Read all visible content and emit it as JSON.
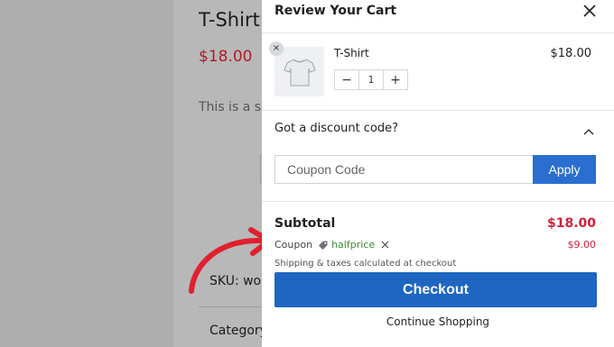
{
  "background_page": {
    "product_title": "T-Shirt",
    "product_price": "$18.00",
    "description_snippet": "This is a sin",
    "sku_snippet": "SKU: woo",
    "category_snippet": "Category"
  },
  "cart": {
    "title": "Review Your Cart",
    "close_icon": "close-icon",
    "items": [
      {
        "name": "T-Shirt",
        "price": "$18.00",
        "quantity": "1",
        "thumbnail": "tshirt-image"
      }
    ],
    "qty_decrement": "−",
    "qty_increment": "+",
    "remove_item": "×"
  },
  "discount": {
    "label": "Got a discount code?",
    "input_placeholder": "Coupon Code",
    "input_value": "",
    "apply_label": "Apply"
  },
  "totals": {
    "subtotal_label": "Subtotal",
    "subtotal_value": "$18.00",
    "coupon_label": "Coupon",
    "coupon_code": "halfprice",
    "coupon_discount": "$9.00",
    "shipping_note": "Shipping & taxes calculated at checkout",
    "checkout_label": "Checkout",
    "continue_label": "Continue Shopping"
  },
  "colors": {
    "accent_blue": "#1e66c1",
    "price_red": "#d0213a",
    "coupon_green": "#3d8a37",
    "annotation_red": "#e0202f"
  }
}
